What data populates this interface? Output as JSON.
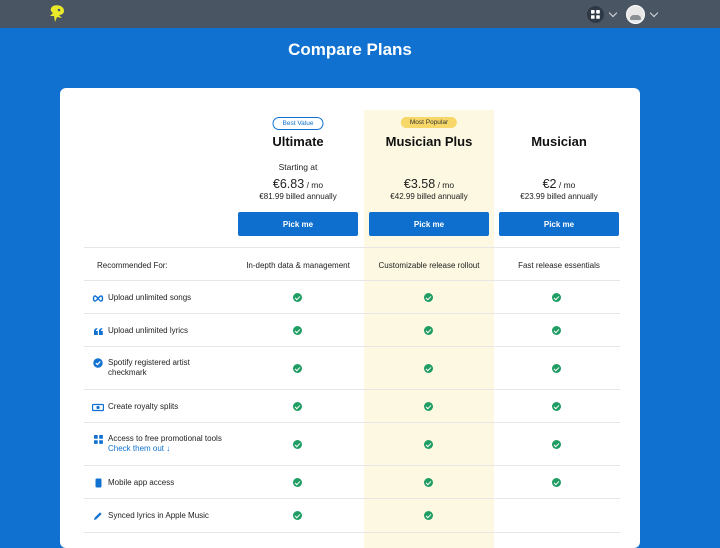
{
  "page": {
    "title": "Compare Plans"
  },
  "colors": {
    "accent": "#1071d1",
    "check": "#1f9d63",
    "highlight": "#fcf8e1",
    "badge_popular": "#f6d768"
  },
  "topbar": {
    "logo_icon": "logo-icon",
    "apps_icon": "grid-icon",
    "user_icon": "avatar-icon"
  },
  "plans": [
    {
      "badge": "Best Value",
      "name": "Ultimate",
      "starting": "Starting at",
      "price": "€6.83",
      "per": "/ mo",
      "billed": "€81.99 billed annually",
      "cta": "Pick me",
      "recommended": "In-depth data & management"
    },
    {
      "badge": "Most Popular",
      "name": "Musician Plus",
      "starting": "",
      "price": "€3.58",
      "per": "/ mo",
      "billed": "€42.99 billed annually",
      "cta": "Pick me",
      "recommended": "Customizable release rollout"
    },
    {
      "badge": "",
      "name": "Musician",
      "starting": "",
      "price": "€2",
      "per": "/ mo",
      "billed": "€23.99 billed annually",
      "cta": "Pick me",
      "recommended": "Fast release essentials"
    }
  ],
  "table": {
    "recommended_label": "Recommended For:",
    "features": [
      {
        "label": "Upload unlimited songs",
        "icon": "infinity-icon",
        "ultimate": true,
        "plus": true,
        "musician": true
      },
      {
        "label": "Upload unlimited lyrics",
        "icon": "quote-icon",
        "ultimate": true,
        "plus": true,
        "musician": true
      },
      {
        "label_line1": "Spotify registered artist",
        "label_line2": "checkmark",
        "icon": "verified-badge-icon",
        "ultimate": true,
        "plus": true,
        "musician": true
      },
      {
        "label": "Create royalty splits",
        "icon": "splits-icon",
        "ultimate": true,
        "plus": true,
        "musician": true
      },
      {
        "label": "Access to free promotional tools",
        "link": "Check them out",
        "icon": "apps-icon",
        "ultimate": true,
        "plus": true,
        "musician": true
      },
      {
        "label": "Mobile app access",
        "icon": "phone-icon",
        "ultimate": true,
        "plus": true,
        "musician": true
      },
      {
        "label": "Synced lyrics in Apple Music",
        "icon": "pen-icon",
        "ultimate": true,
        "plus": true,
        "musician": false
      }
    ]
  }
}
